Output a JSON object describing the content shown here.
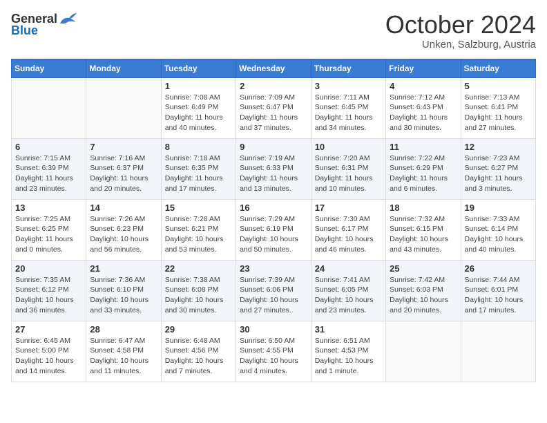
{
  "header": {
    "logo_general": "General",
    "logo_blue": "Blue",
    "month_title": "October 2024",
    "location": "Unken, Salzburg, Austria"
  },
  "weekdays": [
    "Sunday",
    "Monday",
    "Tuesday",
    "Wednesday",
    "Thursday",
    "Friday",
    "Saturday"
  ],
  "weeks": [
    [
      {
        "day": "",
        "info": ""
      },
      {
        "day": "",
        "info": ""
      },
      {
        "day": "1",
        "info": "Sunrise: 7:08 AM\nSunset: 6:49 PM\nDaylight: 11 hours and 40 minutes."
      },
      {
        "day": "2",
        "info": "Sunrise: 7:09 AM\nSunset: 6:47 PM\nDaylight: 11 hours and 37 minutes."
      },
      {
        "day": "3",
        "info": "Sunrise: 7:11 AM\nSunset: 6:45 PM\nDaylight: 11 hours and 34 minutes."
      },
      {
        "day": "4",
        "info": "Sunrise: 7:12 AM\nSunset: 6:43 PM\nDaylight: 11 hours and 30 minutes."
      },
      {
        "day": "5",
        "info": "Sunrise: 7:13 AM\nSunset: 6:41 PM\nDaylight: 11 hours and 27 minutes."
      }
    ],
    [
      {
        "day": "6",
        "info": "Sunrise: 7:15 AM\nSunset: 6:39 PM\nDaylight: 11 hours and 23 minutes."
      },
      {
        "day": "7",
        "info": "Sunrise: 7:16 AM\nSunset: 6:37 PM\nDaylight: 11 hours and 20 minutes."
      },
      {
        "day": "8",
        "info": "Sunrise: 7:18 AM\nSunset: 6:35 PM\nDaylight: 11 hours and 17 minutes."
      },
      {
        "day": "9",
        "info": "Sunrise: 7:19 AM\nSunset: 6:33 PM\nDaylight: 11 hours and 13 minutes."
      },
      {
        "day": "10",
        "info": "Sunrise: 7:20 AM\nSunset: 6:31 PM\nDaylight: 11 hours and 10 minutes."
      },
      {
        "day": "11",
        "info": "Sunrise: 7:22 AM\nSunset: 6:29 PM\nDaylight: 11 hours and 6 minutes."
      },
      {
        "day": "12",
        "info": "Sunrise: 7:23 AM\nSunset: 6:27 PM\nDaylight: 11 hours and 3 minutes."
      }
    ],
    [
      {
        "day": "13",
        "info": "Sunrise: 7:25 AM\nSunset: 6:25 PM\nDaylight: 11 hours and 0 minutes."
      },
      {
        "day": "14",
        "info": "Sunrise: 7:26 AM\nSunset: 6:23 PM\nDaylight: 10 hours and 56 minutes."
      },
      {
        "day": "15",
        "info": "Sunrise: 7:28 AM\nSunset: 6:21 PM\nDaylight: 10 hours and 53 minutes."
      },
      {
        "day": "16",
        "info": "Sunrise: 7:29 AM\nSunset: 6:19 PM\nDaylight: 10 hours and 50 minutes."
      },
      {
        "day": "17",
        "info": "Sunrise: 7:30 AM\nSunset: 6:17 PM\nDaylight: 10 hours and 46 minutes."
      },
      {
        "day": "18",
        "info": "Sunrise: 7:32 AM\nSunset: 6:15 PM\nDaylight: 10 hours and 43 minutes."
      },
      {
        "day": "19",
        "info": "Sunrise: 7:33 AM\nSunset: 6:14 PM\nDaylight: 10 hours and 40 minutes."
      }
    ],
    [
      {
        "day": "20",
        "info": "Sunrise: 7:35 AM\nSunset: 6:12 PM\nDaylight: 10 hours and 36 minutes."
      },
      {
        "day": "21",
        "info": "Sunrise: 7:36 AM\nSunset: 6:10 PM\nDaylight: 10 hours and 33 minutes."
      },
      {
        "day": "22",
        "info": "Sunrise: 7:38 AM\nSunset: 6:08 PM\nDaylight: 10 hours and 30 minutes."
      },
      {
        "day": "23",
        "info": "Sunrise: 7:39 AM\nSunset: 6:06 PM\nDaylight: 10 hours and 27 minutes."
      },
      {
        "day": "24",
        "info": "Sunrise: 7:41 AM\nSunset: 6:05 PM\nDaylight: 10 hours and 23 minutes."
      },
      {
        "day": "25",
        "info": "Sunrise: 7:42 AM\nSunset: 6:03 PM\nDaylight: 10 hours and 20 minutes."
      },
      {
        "day": "26",
        "info": "Sunrise: 7:44 AM\nSunset: 6:01 PM\nDaylight: 10 hours and 17 minutes."
      }
    ],
    [
      {
        "day": "27",
        "info": "Sunrise: 6:45 AM\nSunset: 5:00 PM\nDaylight: 10 hours and 14 minutes."
      },
      {
        "day": "28",
        "info": "Sunrise: 6:47 AM\nSunset: 4:58 PM\nDaylight: 10 hours and 11 minutes."
      },
      {
        "day": "29",
        "info": "Sunrise: 6:48 AM\nSunset: 4:56 PM\nDaylight: 10 hours and 7 minutes."
      },
      {
        "day": "30",
        "info": "Sunrise: 6:50 AM\nSunset: 4:55 PM\nDaylight: 10 hours and 4 minutes."
      },
      {
        "day": "31",
        "info": "Sunrise: 6:51 AM\nSunset: 4:53 PM\nDaylight: 10 hours and 1 minute."
      },
      {
        "day": "",
        "info": ""
      },
      {
        "day": "",
        "info": ""
      }
    ]
  ]
}
